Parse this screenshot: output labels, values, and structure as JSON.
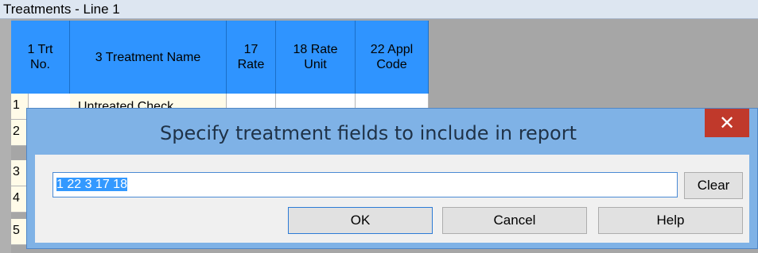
{
  "panel": {
    "title": "Treatments - Line 1"
  },
  "grid": {
    "headers": [
      {
        "label": "1 Trt\nNo."
      },
      {
        "label": "3 Treatment Name"
      },
      {
        "label": "17\nRate"
      },
      {
        "label": "18 Rate\nUnit"
      },
      {
        "label": "22 Appl\nCode"
      }
    ],
    "first_row_name": "Untreated Check",
    "row_numbers": [
      "1",
      "2",
      "3",
      "4",
      "5"
    ]
  },
  "dialog": {
    "title": "Specify treatment fields to include in report",
    "close_icon": "close-icon",
    "input_value": "1 22 3 17 18",
    "clear_label": "Clear",
    "ok_label": "OK",
    "cancel_label": "Cancel",
    "help_label": "Help"
  },
  "colors": {
    "header_blue": "#2f94ff",
    "dialog_frame": "#7fb2e6",
    "close_red": "#c0392b",
    "selection": "#3399ff"
  }
}
